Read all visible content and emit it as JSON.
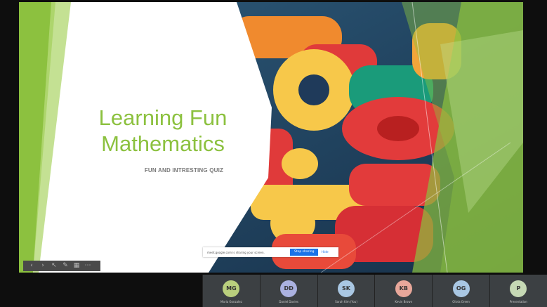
{
  "slide": {
    "title_line1": "Learning Fun",
    "title_line2": "Mathematics",
    "subtitle": "FUN AND INTRESTING QUIZ"
  },
  "toolbar": {
    "items": [
      {
        "icon": "prev-icon",
        "glyph": "‹"
      },
      {
        "icon": "next-icon",
        "glyph": "›"
      },
      {
        "icon": "pointer-icon",
        "glyph": "↖"
      },
      {
        "icon": "pen-icon",
        "glyph": "✎"
      },
      {
        "icon": "grid-icon",
        "glyph": "▦"
      },
      {
        "icon": "more-icon",
        "glyph": "⋯"
      }
    ]
  },
  "share_bar": {
    "message": "meet.google.com is sharing your screen.",
    "stop_label": "Stop sharing",
    "hide_label": "Hide"
  },
  "participants": [
    {
      "initials": "MG",
      "name": "Maria Gonzalez",
      "color": "#b9cf7d"
    },
    {
      "initials": "DD",
      "name": "Daniel Davies",
      "color": "#aab1e0"
    },
    {
      "initials": "SK",
      "name": "Sarah Kim (You)",
      "color": "#a9c7e3"
    },
    {
      "initials": "KB",
      "name": "Kevin Brown",
      "color": "#e8a79a"
    },
    {
      "initials": "OG",
      "name": "Olivia Green",
      "color": "#a9c7e3"
    },
    {
      "initials": "P",
      "name": "Presentation",
      "color": "#c5d8b4"
    }
  ],
  "colors": {
    "accent": "#8cc13f",
    "stop": "#1a73e8",
    "tile": "#3c4043"
  }
}
